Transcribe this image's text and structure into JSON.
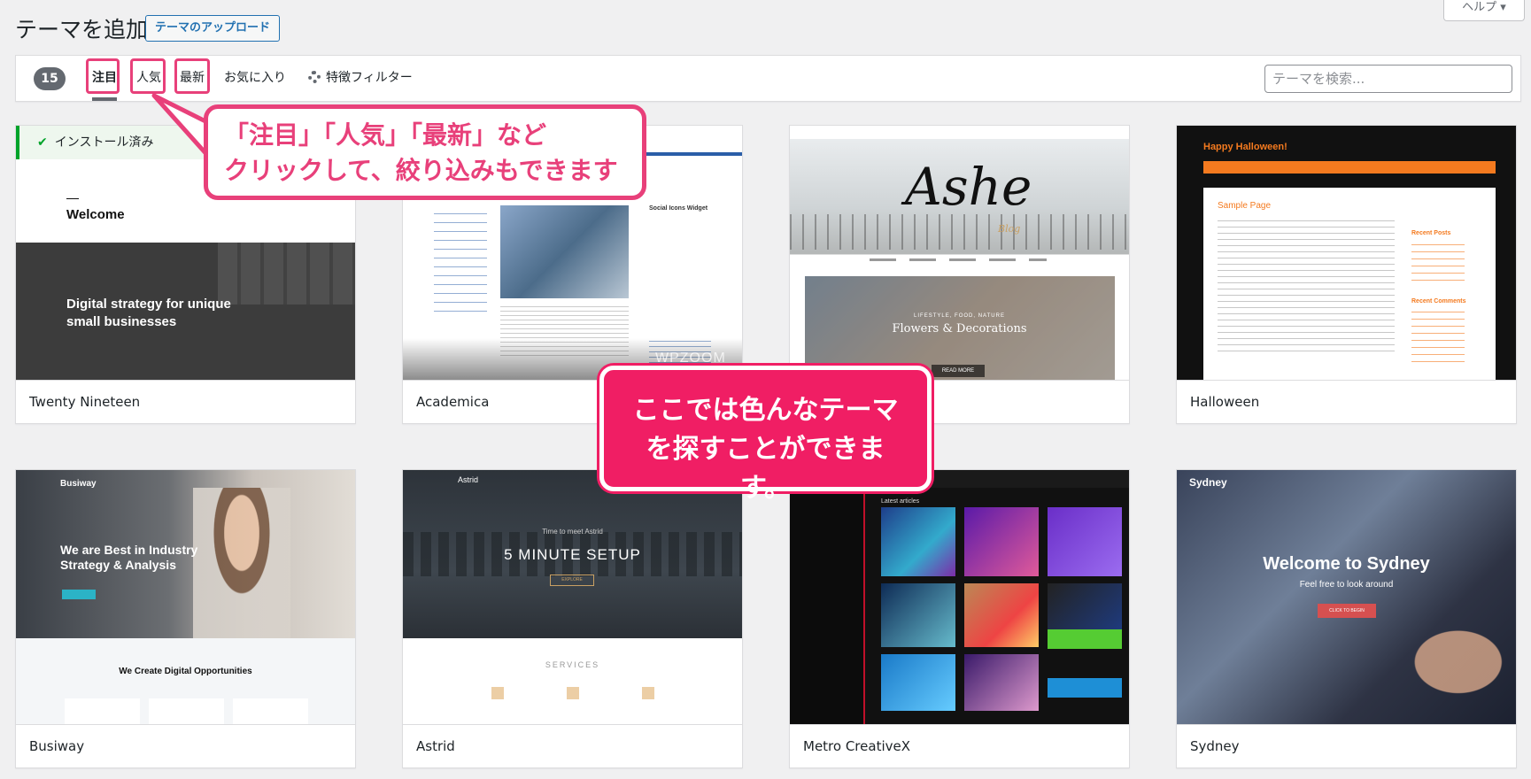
{
  "header": {
    "title": "テーマを追加",
    "upload_label": "テーマのアップロード",
    "help_label": "ヘルプ ▾"
  },
  "filter": {
    "count": "15",
    "tabs": [
      "注目",
      "人気",
      "最新",
      "お気に入り"
    ],
    "feature_filter": "特徴フィルター",
    "search_placeholder": "テーマを検索..."
  },
  "themes": [
    {
      "name": "Twenty Nineteen",
      "installed_label": "インストール済み",
      "preview": {
        "headline": "Welcome",
        "tagline": "Digital strategy for unique small businesses"
      }
    },
    {
      "name": "Academica",
      "preview": {
        "widget": "Social Icons Widget",
        "watermark": "WPZOOM"
      }
    },
    {
      "name": "Ashe",
      "preview": {
        "logo": "Ashe",
        "sub": "Blog",
        "banner": "Flowers & Decorations",
        "banner_kicker": "LIFESTYLE, FOOD, NATURE",
        "cta": "READ MORE"
      }
    },
    {
      "name": "Halloween",
      "preview": {
        "title": "Happy Halloween!",
        "page_title": "Sample Page",
        "side1": "Recent Posts",
        "side2": "Recent Comments"
      }
    },
    {
      "name": "Busiway",
      "preview": {
        "logo": "Busiway",
        "hero": "We are Best in Industry Strategy & Analysis",
        "section": "We Create Digital Opportunities"
      }
    },
    {
      "name": "Astrid",
      "preview": {
        "logo": "Astrid",
        "kicker": "Time to meet Astrid",
        "hero": "5 MINUTE SETUP",
        "btn": "EXPLORE",
        "section": "SERVICES"
      }
    },
    {
      "name": "Metro CreativeX",
      "preview": {
        "heading": "Latest articles"
      }
    },
    {
      "name": "Sydney",
      "preview": {
        "logo": "Sydney",
        "hero": "Welcome to Sydney",
        "sub": "Feel free to look around",
        "btn": "CLICK TO BEGIN"
      }
    }
  ],
  "annotations": {
    "callout1": [
      "「注目」「人気」「最新」など",
      "クリックして、絞り込みもできます"
    ],
    "callout2": [
      "ここでは色んなテーマ",
      "を探すことができます。"
    ]
  },
  "colors": {
    "accent": "#2271b1",
    "callout": "#e8407a",
    "installed": "#00a32a"
  }
}
